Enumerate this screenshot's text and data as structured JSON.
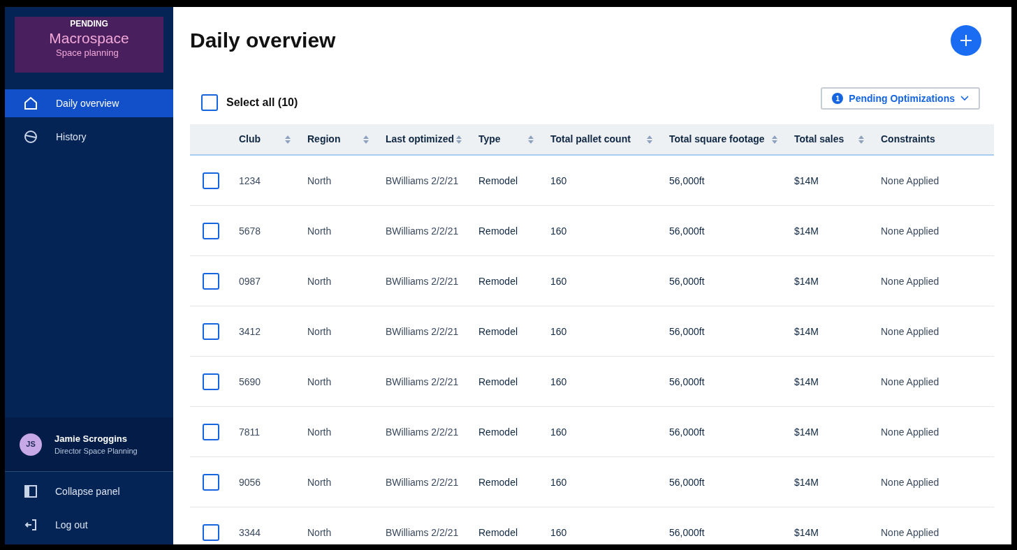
{
  "brand": {
    "status": "PENDING",
    "name": "Macrospace",
    "subtitle": "Space planning"
  },
  "nav": [
    {
      "kind": "home",
      "label": "Daily overview",
      "selected": true
    },
    {
      "kind": "history",
      "label": "History",
      "selected": false
    }
  ],
  "user": {
    "initials": "JS",
    "name": "Jamie Scroggins",
    "role": "Director Space Planning"
  },
  "footer_nav": [
    {
      "kind": "collapse",
      "label": "Collapse panel"
    },
    {
      "kind": "logout",
      "label": "Log out"
    }
  ],
  "page": {
    "title": "Daily overview"
  },
  "select_all": {
    "label": "Select all (10)",
    "checked": false
  },
  "filter": {
    "badge": "1",
    "label": "Pending Optimizations"
  },
  "table": {
    "columns": [
      {
        "label": "Club",
        "kind": "sortable"
      },
      {
        "label": "Region",
        "kind": "sortable"
      },
      {
        "label": "Last optimized",
        "kind": "sortable"
      },
      {
        "label": "Type",
        "kind": "sortable"
      },
      {
        "label": "Total pallet count",
        "kind": "sortable"
      },
      {
        "label": "Total square footage",
        "kind": "sortable"
      },
      {
        "label": "Total sales",
        "kind": "sortable"
      },
      {
        "label": "Constraints",
        "kind": "plain"
      }
    ],
    "rows": [
      {
        "checked": false,
        "cells": [
          "1234",
          "North",
          "BWilliams 2/2/21",
          "Remodel",
          "160",
          "56,000ft",
          "$14M",
          "None Applied"
        ]
      },
      {
        "checked": false,
        "cells": [
          "5678",
          "North",
          "BWilliams 2/2/21",
          "Remodel",
          "160",
          "56,000ft",
          "$14M",
          "None Applied"
        ]
      },
      {
        "checked": false,
        "cells": [
          "0987",
          "North",
          "BWilliams 2/2/21",
          "Remodel",
          "160",
          "56,000ft",
          "$14M",
          "None Applied"
        ]
      },
      {
        "checked": false,
        "cells": [
          "3412",
          "North",
          "BWilliams 2/2/21",
          "Remodel",
          "160",
          "56,000ft",
          "$14M",
          "None Applied"
        ]
      },
      {
        "checked": false,
        "cells": [
          "5690",
          "North",
          "BWilliams 2/2/21",
          "Remodel",
          "160",
          "56,000ft",
          "$14M",
          "None Applied"
        ]
      },
      {
        "checked": false,
        "cells": [
          "7811",
          "North",
          "BWilliams 2/2/21",
          "Remodel",
          "160",
          "56,000ft",
          "$14M",
          "None Applied"
        ]
      },
      {
        "checked": false,
        "cells": [
          "9056",
          "North",
          "BWilliams 2/2/21",
          "Remodel",
          "160",
          "56,000ft",
          "$14M",
          "None Applied"
        ]
      },
      {
        "checked": false,
        "cells": [
          "3344",
          "North",
          "BWilliams 2/2/21",
          "Remodel",
          "160",
          "56,000ft",
          "$14M",
          "None Applied"
        ]
      }
    ]
  }
}
